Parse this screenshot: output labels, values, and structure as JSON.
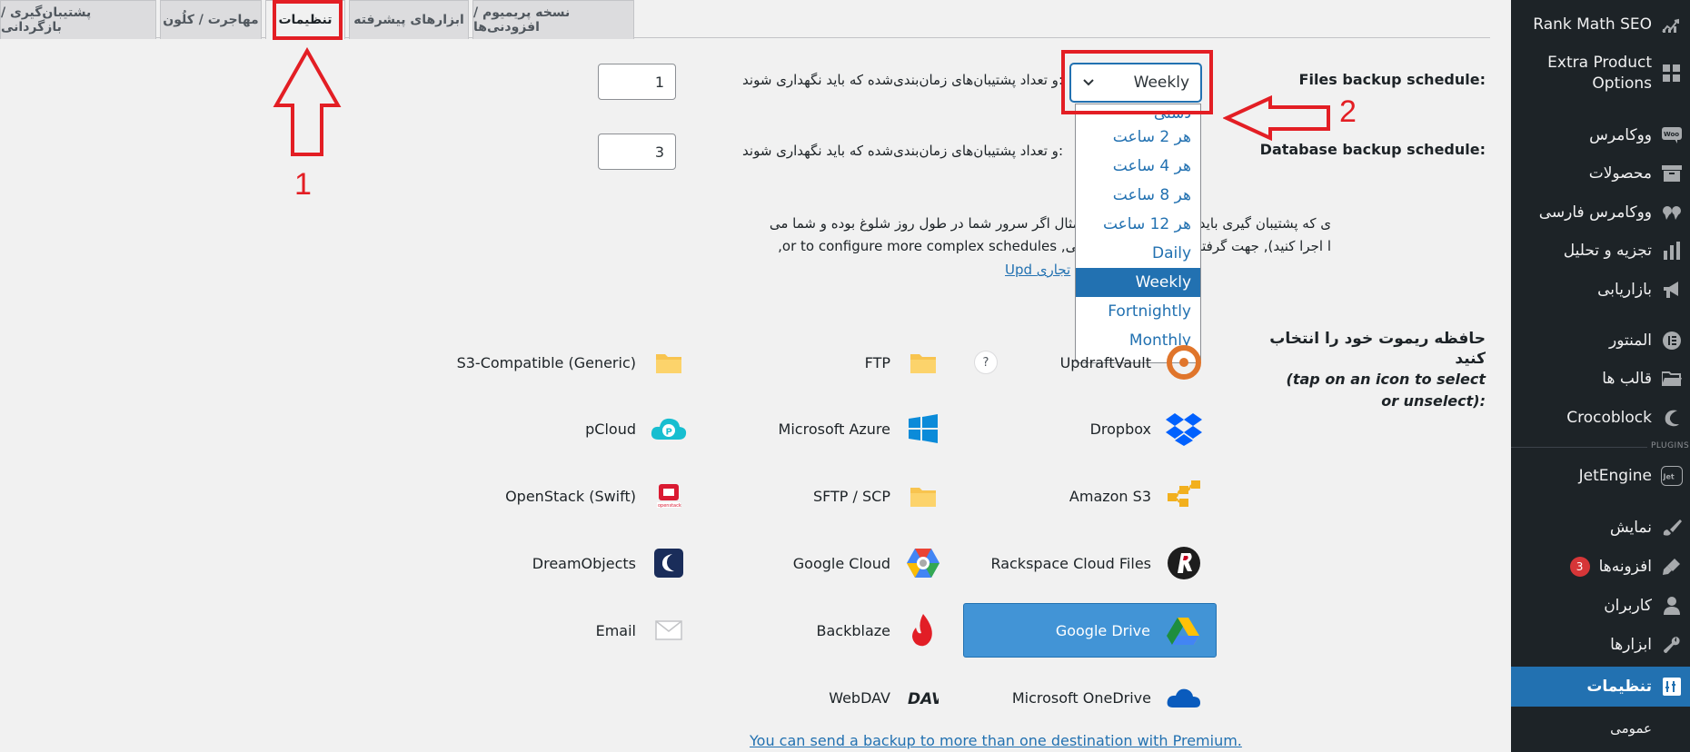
{
  "sidebar": {
    "items": [
      {
        "label": "Rank Math SEO",
        "icon": "rank-math-icon"
      },
      {
        "label": "Extra Product Options",
        "icon": "grid-icon"
      },
      {
        "label": "ووکامرس",
        "icon": "woo-icon"
      },
      {
        "label": "محصولات",
        "icon": "archive-icon"
      },
      {
        "label": "ووکامرس فارسی",
        "icon": "quote-icon"
      },
      {
        "label": "تجزیه و تحلیل",
        "icon": "bar-chart-icon"
      },
      {
        "label": "بازاریابی",
        "icon": "megaphone-icon"
      },
      {
        "label": "المنتور",
        "icon": "elementor-icon"
      },
      {
        "label": "قالب ها",
        "icon": "folder-icon"
      },
      {
        "label": "Crocoblock",
        "icon": "crocoblock-icon"
      },
      {
        "label": "JetEngine",
        "icon": "jetengine-icon"
      },
      {
        "label": "نمایش",
        "icon": "brush-icon"
      },
      {
        "label": "افزونه‌ها",
        "icon": "plugin-icon",
        "badge": "3"
      },
      {
        "label": "کاربران",
        "icon": "user-icon"
      },
      {
        "label": "ابزارها",
        "icon": "wrench-icon"
      },
      {
        "label": "تنظیمات",
        "icon": "settings-icon"
      },
      {
        "label": "عمومی",
        "icon": ""
      }
    ],
    "plugins_tag": "PLUGINS",
    "accent": "#2271b1",
    "bg": "#1d2327"
  },
  "tabs": [
    {
      "label": "پشتیبان‌گیری / بازگردانی"
    },
    {
      "label": "مهاجرت / کلُون"
    },
    {
      "label": "تنظیمات"
    },
    {
      "label": "ابزارهای پیشرفته"
    },
    {
      "label": "نسخه پریمیوم / افزودنی‌ها"
    }
  ],
  "settings": {
    "files_label": "Files backup schedule:",
    "database_label": "Database backup schedule:",
    "retain_text": "و تعداد پشتیبان‌های زمان‌بندی‌شده که باید نگهداری شوند:",
    "files_retain": "1",
    "database_retain": "3",
    "schedule_value": "Weekly",
    "schedule_options": [
      "دستی",
      "هر 2 ساعت",
      "هر 4 ساعت",
      "هر 8 ساعت",
      "هر 12 ساعت",
      "Daily",
      "Weekly",
      "Fortnightly",
      "Monthly"
    ],
    "selected_option": "Weekly"
  },
  "description": {
    "line1": "ی که پشتیبان گیری باید اجرا شود , (به طور مثال اگر سرور شما در طول روز شلوغ بوده و شما می",
    "line2": "ا اجرا کنید), جهت گرفتن پشتیبان های افزایشی, or to configure more complex schedules,",
    "line3_link": "Upd تجاری"
  },
  "annotations": {
    "num1": "1",
    "num2": "2",
    "color": "#e31e24"
  },
  "remote": {
    "title": "حافظه ریموت خود را انتخاب کنید",
    "hint": "(tap on an icon to select or unselect):",
    "help": "?",
    "destinations": [
      {
        "label": "S3-Compatible (Generic)",
        "icon": "folder-icon"
      },
      {
        "label": "FTP",
        "icon": "folder-icon"
      },
      {
        "label": "UpdraftVault",
        "icon": "updraftvault-icon"
      },
      {
        "label": "pCloud",
        "icon": "pcloud-icon"
      },
      {
        "label": "Microsoft Azure",
        "icon": "windows-icon"
      },
      {
        "label": "Dropbox",
        "icon": "dropbox-icon"
      },
      {
        "label": "OpenStack (Swift)",
        "icon": "openstack-icon"
      },
      {
        "label": "SFTP / SCP",
        "icon": "folder-icon"
      },
      {
        "label": "Amazon S3",
        "icon": "amazon-s3-icon"
      },
      {
        "label": "DreamObjects",
        "icon": "dreamobjects-icon"
      },
      {
        "label": "Google Cloud",
        "icon": "google-cloud-icon"
      },
      {
        "label": "Rackspace Cloud Files",
        "icon": "rackspace-icon"
      },
      {
        "label": "Email",
        "icon": "envelope-icon"
      },
      {
        "label": "Backblaze",
        "icon": "backblaze-icon"
      },
      {
        "label": "Google Drive",
        "icon": "google-drive-icon"
      },
      {
        "label": "WebDAV",
        "icon": "webdav-icon"
      },
      {
        "label": "Microsoft OneDrive",
        "icon": "onedrive-icon"
      }
    ],
    "selected": "Google Drive",
    "premium_link": "You can send a backup to more than one destination with Premium."
  }
}
